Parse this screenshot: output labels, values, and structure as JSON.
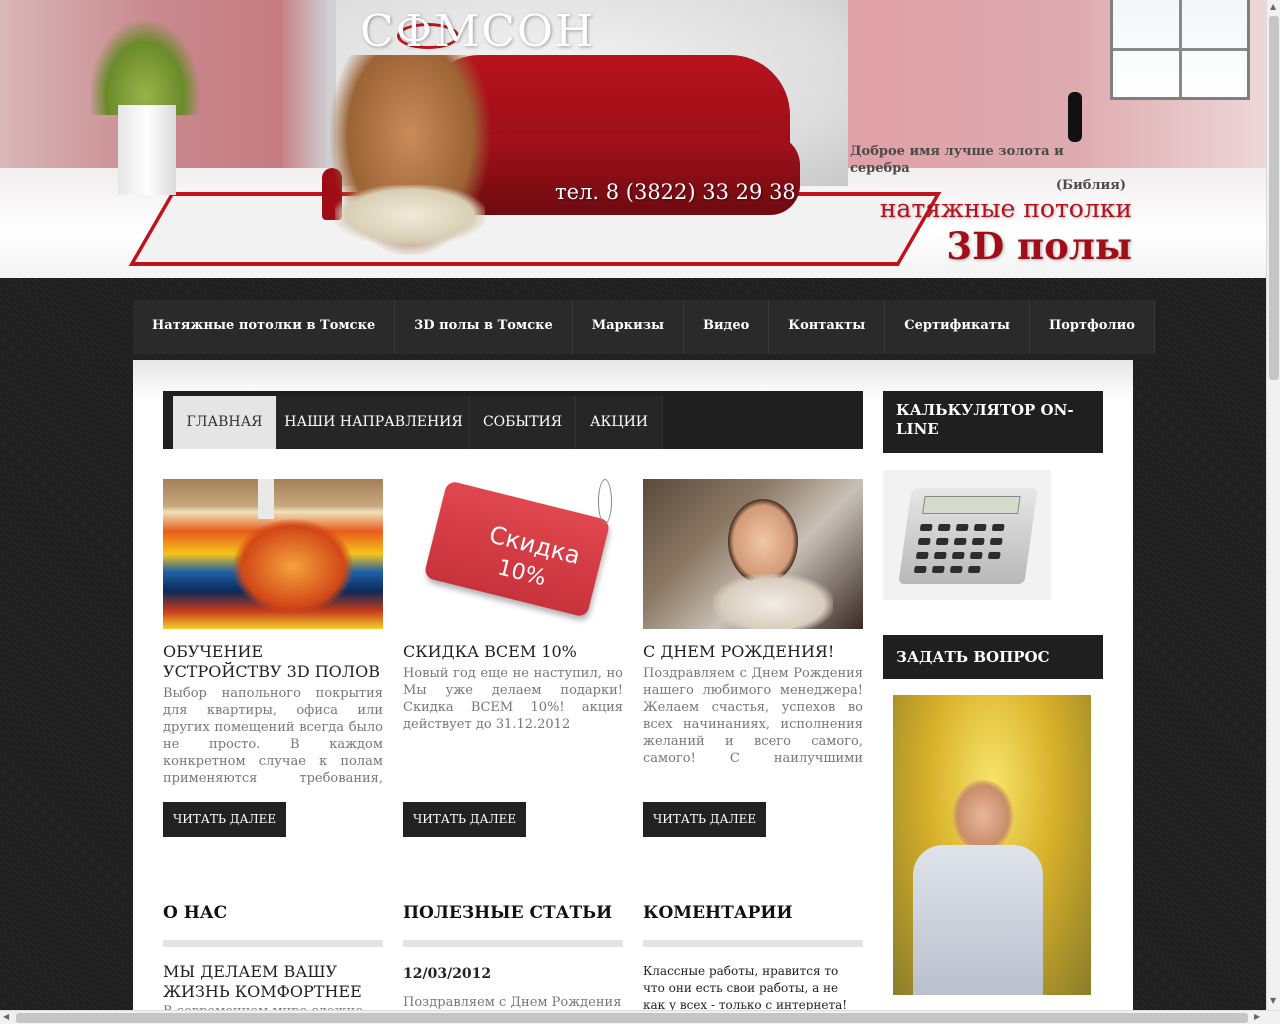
{
  "header": {
    "logo": "СФМСОН",
    "phone": "тел. 8 (3822) 33 29 38",
    "quote": "Доброе имя лучше золота и серебра",
    "quote_source": "(Библия)",
    "tagline_1": "натяжные потолки",
    "tagline_2": "3D полы"
  },
  "topnav": [
    {
      "label": "Натяжные потолки в Томске"
    },
    {
      "label": "3D полы в Томске"
    },
    {
      "label": "Маркизы"
    },
    {
      "label": "Видео"
    },
    {
      "label": "Контакты"
    },
    {
      "label": "Сертификаты"
    },
    {
      "label": "Портфолио"
    }
  ],
  "tabs": [
    {
      "label": "ГЛАВНАЯ",
      "active": true
    },
    {
      "label": "НАШИ НАПРАВЛЕНИЯ",
      "active": false
    },
    {
      "label": "СОБЫТИЯ",
      "active": false
    },
    {
      "label": "АКЦИИ",
      "active": false
    }
  ],
  "cards": [
    {
      "title": "ОБУЧЕНИЕ УСТРОЙСТВУ 3D ПОЛОВ",
      "text": "Выбор напольного покрытия для квартиры, офиса или других помещений всегда было не просто. В каждом конкретном случае к полам применяются требования, удовлетворить которым не так...",
      "button": "ЧИТАТЬ ДАЛЕЕ"
    },
    {
      "title": "СКИДКА ВСЕМ 10%",
      "text": "Новый год еще не наступил, но Мы уже делаем подарки! Скидка ВСЕМ 10%! акция действует до 31.12.2012",
      "button": "ЧИТАТЬ ДАЛЕЕ",
      "tag_line1": "Скидка",
      "tag_line2": "10%"
    },
    {
      "title": "С ДНЕМ РОЖДЕНИЯ!",
      "text": "Поздравляем с Днем Рождения нашего любимого менеджера! Желаем счастья, успехов во всех начинаниях, исполнения желаний и всего самого, самого! С наилучшими пожеланиями, компани...",
      "button": "ЧИТАТЬ ДАЛЕЕ"
    }
  ],
  "columns": {
    "about": {
      "heading": "О НАС",
      "subheading": "МЫ ДЕЛАЕМ ВАШУ ЖИЗНЬ КОМФОРТНЕЕ",
      "text": "В современном мире сложно найти"
    },
    "articles": {
      "heading": "ПОЛЕЗНЫЕ СТАТЬИ",
      "date": "12/03/2012",
      "text": "Поздравляем с Днем Рождения"
    },
    "comments": {
      "heading": "КОМЕНТАРИИ",
      "text": "Классные работы, нравится то что они есть свои работы, а не как у всех - только с интернета! ребята"
    }
  },
  "sidebar": {
    "calculator_heading": "КАЛЬКУЛЯТОР ON-LINE",
    "question_heading": "ЗАДАТЬ ВОПРОС"
  },
  "colors": {
    "brand_red": "#b5121b",
    "nav_bg": "#262626",
    "page_bg": "#1b1b1b"
  }
}
